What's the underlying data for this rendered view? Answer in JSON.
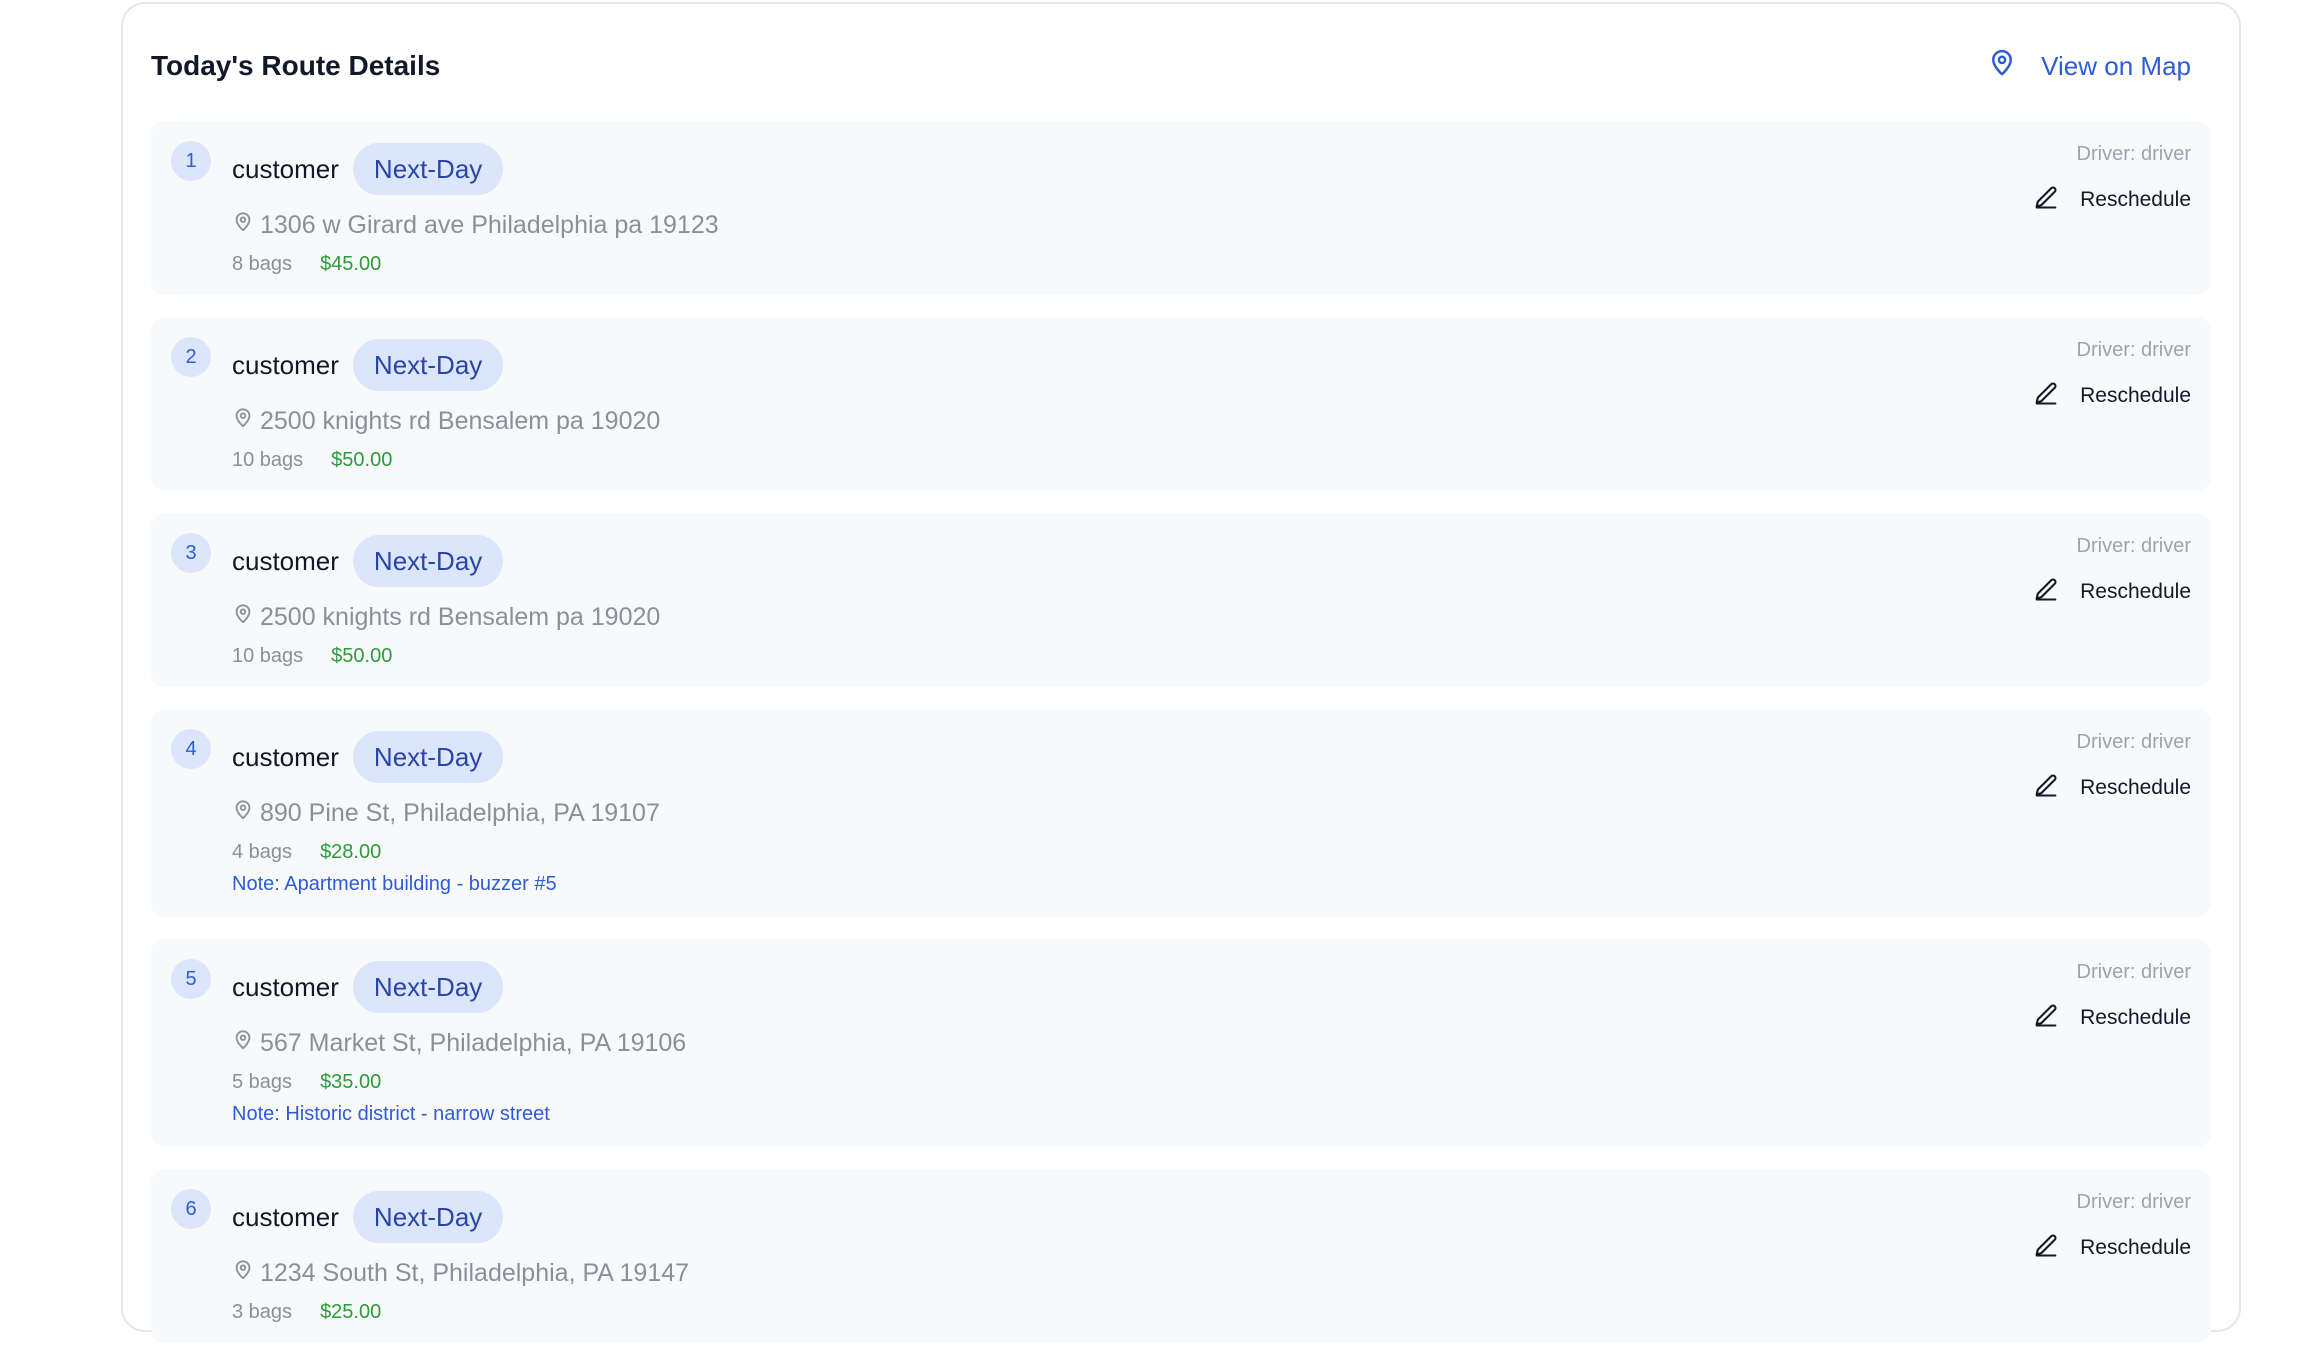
{
  "header": {
    "title": "Today's Route Details",
    "map_button": "View on Map",
    "map_icon": "map-pin-icon"
  },
  "colors": {
    "accent": "#2f5bd6",
    "badge_bg": "#dbe5fb",
    "price": "#2f9a3a",
    "card_bg": "#f8f9fb"
  },
  "stops": [
    {
      "number": "1",
      "customer": "customer",
      "badge": "Next-Day",
      "address": "1306 w Girard ave Philadelphia pa 19123",
      "bags": "8 bags",
      "price": "$45.00",
      "note": "",
      "driver": "Driver: driver",
      "action": "Reschedule"
    },
    {
      "number": "2",
      "customer": "customer",
      "badge": "Next-Day",
      "address": "2500 knights rd Bensalem pa 19020",
      "bags": "10 bags",
      "price": "$50.00",
      "note": "",
      "driver": "Driver: driver",
      "action": "Reschedule"
    },
    {
      "number": "3",
      "customer": "customer",
      "badge": "Next-Day",
      "address": "2500 knights rd Bensalem pa 19020",
      "bags": "10 bags",
      "price": "$50.00",
      "note": "",
      "driver": "Driver: driver",
      "action": "Reschedule"
    },
    {
      "number": "4",
      "customer": "customer",
      "badge": "Next-Day",
      "address": "890 Pine St, Philadelphia, PA 19107",
      "bags": "4 bags",
      "price": "$28.00",
      "note": "Note: Apartment building - buzzer #5",
      "driver": "Driver: driver",
      "action": "Reschedule"
    },
    {
      "number": "5",
      "customer": "customer",
      "badge": "Next-Day",
      "address": "567 Market St, Philadelphia, PA 19106",
      "bags": "5 bags",
      "price": "$35.00",
      "note": "Note: Historic district - narrow street",
      "driver": "Driver: driver",
      "action": "Reschedule"
    },
    {
      "number": "6",
      "customer": "customer",
      "badge": "Next-Day",
      "address": "1234 South St, Philadelphia, PA 19147",
      "bags": "3 bags",
      "price": "$25.00",
      "note": "",
      "driver": "Driver: driver",
      "action": "Reschedule"
    }
  ]
}
